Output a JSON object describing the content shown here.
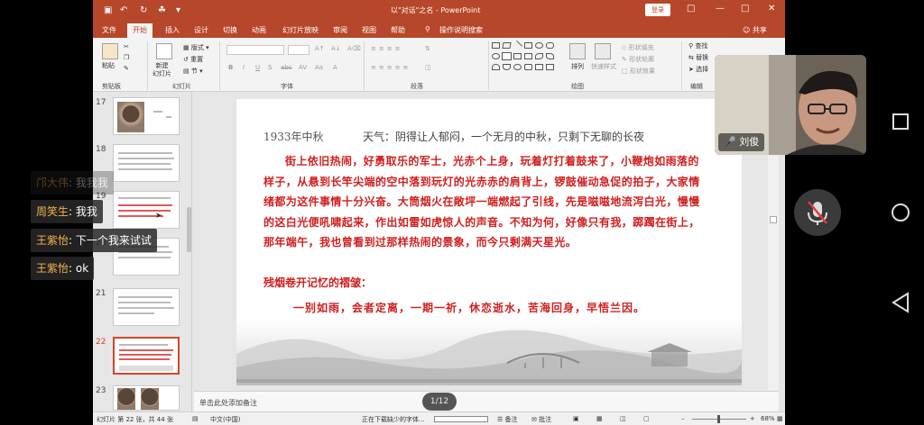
{
  "window": {
    "title": "以\"对话\"之名 - PowerPoint",
    "login_label": "登录",
    "quick_access": [
      "▣",
      "↶",
      "↻",
      "☘",
      "▾"
    ],
    "window_buttons": [
      "□",
      "—",
      "□",
      "✕"
    ]
  },
  "tabs": [
    "文件",
    "开始",
    "插入",
    "设计",
    "切换",
    "动画",
    "幻灯片放映",
    "审阅",
    "视图",
    "帮助",
    "操作说明搜索"
  ],
  "active_tab": "开始",
  "share_label": "共享",
  "ribbon": {
    "paste": "粘贴",
    "new_slide": "新建\n幻灯片",
    "layout": "版式",
    "reset": "重置",
    "section": "节",
    "arrange": "排列",
    "quick_styles": "快速样式",
    "shape_fill": "形状填充",
    "shape_outline": "形状轮廓",
    "shape_effects": "形状效果",
    "find": "查找",
    "replace": "替换",
    "select": "选择",
    "groups": [
      "剪贴板",
      "幻灯片",
      "字体",
      "段落",
      "绘图",
      "编辑"
    ]
  },
  "slides": [
    {
      "num": "17"
    },
    {
      "num": "18"
    },
    {
      "num": "19"
    },
    {
      "num": "20"
    },
    {
      "num": "21"
    },
    {
      "num": "22"
    },
    {
      "num": "23"
    }
  ],
  "slide": {
    "date": "1933年中秋",
    "weather": "天气：阴得让人郁闷，一个无月的中秋，只剩下无聊的长夜",
    "body": "街上依旧热闹，好勇取乐的军士，光赤个上身，玩着灯打着鼓来了，小鞭炮如雨落的样子，从悬到长竿尖端的空中落到玩灯的光赤赤的肩背上，锣鼓催动急促的拍子，大家情绪都为这件事情十分兴奋。大筒烟火在敞坪一端燃起了引线，先是嗞嗞地流泻白光，慢慢的这白光便吼啸起来，作出如雷如虎惊人的声音。不知为何，好像只有我，踯躅在街上，那年端午，我也曾看到过那样热闹的景象，而今只剩满天星光。",
    "heading": "残烟卷开记忆的褶皱：",
    "verse": "一别如雨，会者定离，一期一祈，休恋逝水，苦海回身，早悟兰因。"
  },
  "notes_placeholder": "单击此处添加备注",
  "page_indicator": "1/12",
  "status": {
    "slide_info": "幻灯片 第 22 张，共 44 张",
    "language": "中文(中国)",
    "downloading": "正在下载缺少的字体...",
    "notes_btn": "备注",
    "comments_btn": "批注",
    "zoom": "68%"
  },
  "chat": [
    {
      "name": "邝大伟",
      "text": "我我我",
      "faded": true
    },
    {
      "name": "周笑生",
      "text": "我我"
    },
    {
      "name": "王紫怡",
      "text": "下一个我来试试"
    },
    {
      "name": "王紫怡",
      "text": "ok"
    }
  ],
  "camera": {
    "name": "刘俊"
  }
}
